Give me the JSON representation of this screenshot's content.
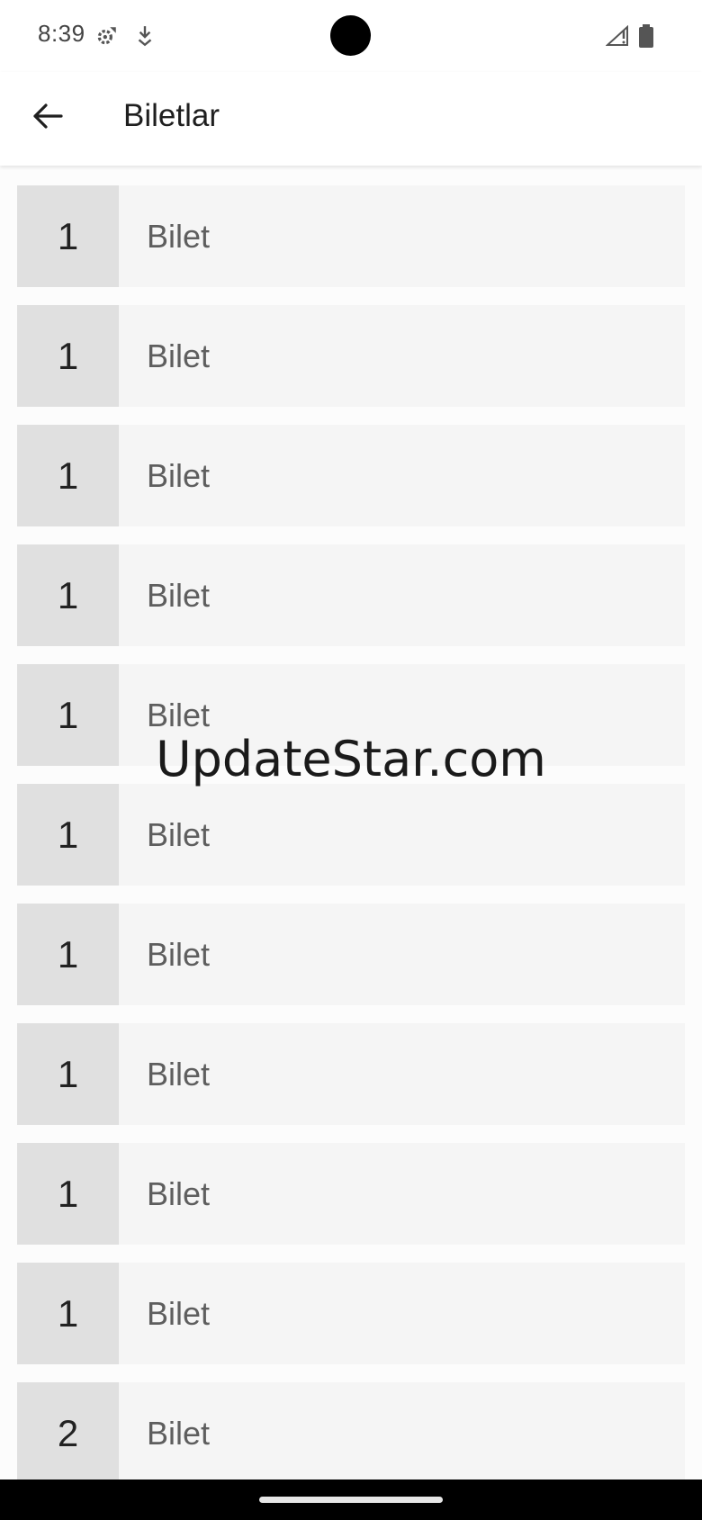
{
  "status_bar": {
    "time": "8:39",
    "icons": [
      "gear-icon",
      "download-icon",
      "signal-icon",
      "battery-icon"
    ]
  },
  "app_bar": {
    "title": "Biletlar",
    "back_icon": "arrow-back-icon"
  },
  "tickets": [
    {
      "count": "1",
      "label": "Bilet"
    },
    {
      "count": "1",
      "label": "Bilet"
    },
    {
      "count": "1",
      "label": "Bilet"
    },
    {
      "count": "1",
      "label": "Bilet"
    },
    {
      "count": "1",
      "label": "Bilet"
    },
    {
      "count": "1",
      "label": "Bilet"
    },
    {
      "count": "1",
      "label": "Bilet"
    },
    {
      "count": "1",
      "label": "Bilet"
    },
    {
      "count": "1",
      "label": "Bilet"
    },
    {
      "count": "1",
      "label": "Bilet"
    },
    {
      "count": "2",
      "label": "Bilet"
    }
  ],
  "watermark": "UpdateStar.com",
  "colors": {
    "count_bg": "#e0e0e0",
    "label_bg": "#f5f5f5",
    "label_text": "#5e5e5e"
  }
}
